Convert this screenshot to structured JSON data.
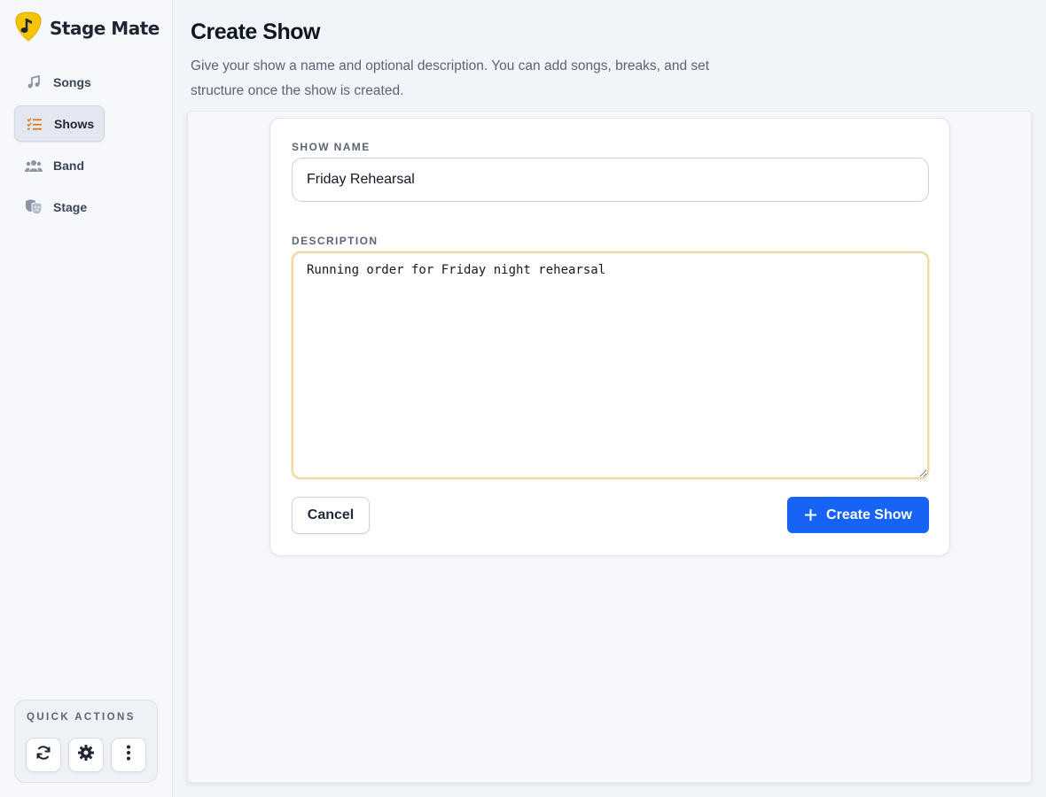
{
  "app": {
    "name": "Stage Mate",
    "accent": "#1663f5",
    "logo_icon": "guitar-pick-note-icon"
  },
  "sidebar": {
    "items": [
      {
        "label": "Songs",
        "icon": "music-note-icon"
      },
      {
        "label": "Shows",
        "icon": "list-check-icon",
        "active": true
      },
      {
        "label": "Band",
        "icon": "users-icon"
      },
      {
        "label": "Stage",
        "icon": "theater-masks-icon"
      }
    ],
    "quick_actions": {
      "title": "QUICK ACTIONS",
      "buttons": [
        {
          "icon": "refresh-icon"
        },
        {
          "icon": "gear-icon"
        },
        {
          "icon": "more-vertical-icon"
        }
      ]
    }
  },
  "header": {
    "title": "Create Show",
    "subtitle_line1": "Give your show a name and optional description. You can add songs, breaks, and set",
    "subtitle_line2": "structure once the show is created."
  },
  "form": {
    "name_label": "SHOW NAME",
    "name_value": "Friday Rehearsal",
    "description_label": "DESCRIPTION",
    "description_value": "Running order for Friday night rehearsal",
    "cancel_label": "Cancel",
    "create_label": "Create Show"
  }
}
